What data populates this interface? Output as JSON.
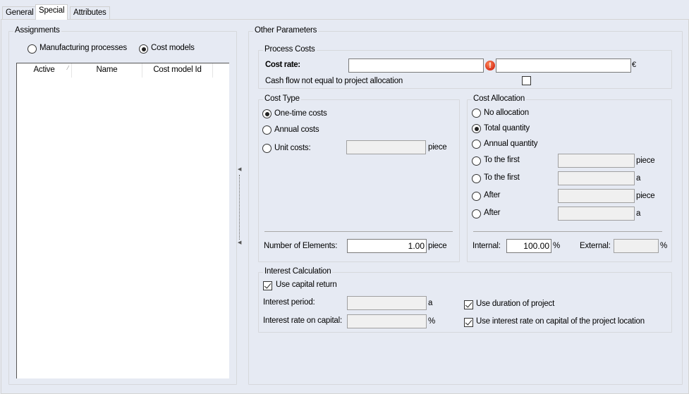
{
  "tabs": [
    {
      "label": "General",
      "active": false
    },
    {
      "label": "Special",
      "active": true
    },
    {
      "label": "Attributes",
      "active": false
    }
  ],
  "assignments": {
    "title": "Assignments",
    "options": [
      {
        "label": "Manufacturing processes",
        "checked": false
      },
      {
        "label": "Cost models",
        "checked": true
      }
    ],
    "columns": [
      "Active",
      "Name",
      "Cost model Id"
    ],
    "sort_glyph": "⁄",
    "rows": []
  },
  "other_parameters": {
    "title": "Other Parameters",
    "process_costs": {
      "title": "Process Costs",
      "cost_rate_label": "Cost rate:",
      "cost_rate_value": "",
      "cost_rate_value2": "",
      "error_icon": "!",
      "currency": "€",
      "cash_flow_label": "Cash flow not equal to project allocation",
      "cash_flow_checked": false
    },
    "cost_type": {
      "title": "Cost Type",
      "options": [
        {
          "label": "One-time costs",
          "checked": true
        },
        {
          "label": "Annual costs",
          "checked": false
        },
        {
          "label": "Unit costs:",
          "checked": false
        }
      ],
      "unit_costs_value": "",
      "unit_costs_unit": "piece",
      "number_of_elements_label": "Number of Elements:",
      "number_of_elements_value": "1.00",
      "number_of_elements_unit": "piece"
    },
    "cost_allocation": {
      "title": "Cost Allocation",
      "options": [
        {
          "label": "No allocation",
          "checked": false
        },
        {
          "label": "Total quantity",
          "checked": true
        },
        {
          "label": "Annual quantity",
          "checked": false
        },
        {
          "label": "To the first",
          "checked": false,
          "value": "",
          "unit": "piece"
        },
        {
          "label": "To the first",
          "checked": false,
          "value": "",
          "unit": "a"
        },
        {
          "label": "After",
          "checked": false,
          "value": "",
          "unit": "piece"
        },
        {
          "label": "After",
          "checked": false,
          "value": "",
          "unit": "a"
        }
      ],
      "internal_label": "Internal:",
      "internal_value": "100.00",
      "internal_unit": "%",
      "external_label": "External:",
      "external_value": "",
      "external_unit": "%"
    },
    "interest_calculation": {
      "title": "Interest Calculation",
      "use_capital_return_label": "Use capital return",
      "use_capital_return_checked": true,
      "interest_period_label": "Interest period:",
      "interest_period_value": "",
      "interest_period_unit": "a",
      "interest_rate_label": "Interest rate on capital:",
      "interest_rate_value": "",
      "interest_rate_unit": "%",
      "use_duration_label": "Use duration of project",
      "use_duration_checked": true,
      "use_location_rate_label": "Use interest rate on capital of the project location",
      "use_location_rate_checked": true
    }
  }
}
